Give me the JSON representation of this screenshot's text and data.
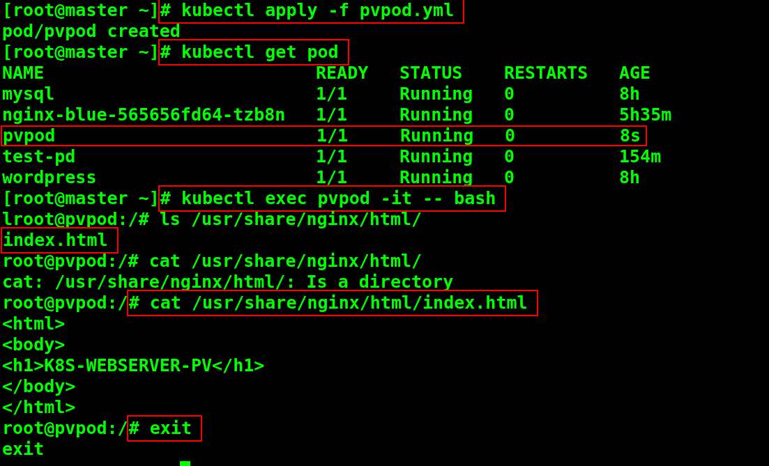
{
  "lines": [
    {
      "kind": "text",
      "parts": [
        {
          "text": "[root@master ~]",
          "boxed": false
        },
        {
          "text": "# kubectl apply -f pvpod.yml",
          "boxed": true
        }
      ]
    },
    {
      "kind": "text",
      "parts": [
        {
          "text": "pod/pvpod created",
          "boxed": false
        }
      ]
    },
    {
      "kind": "text",
      "parts": [
        {
          "text": "[root@master ~]",
          "boxed": false
        },
        {
          "text": "# kubectl get pod",
          "boxed": true
        }
      ]
    },
    {
      "kind": "table",
      "columns": [
        "NAME",
        "READY",
        "STATUS",
        "RESTARTS",
        "AGE"
      ],
      "rows": [
        {
          "boxed": false,
          "cells": [
            "mysql",
            "1/1",
            "Running",
            "0",
            "8h"
          ]
        },
        {
          "boxed": false,
          "cells": [
            "nginx-blue-565656fd64-tzb8n",
            "1/1",
            "Running",
            "0",
            "5h35m"
          ]
        },
        {
          "boxed": true,
          "cells": [
            "pvpod",
            "1/1",
            "Running",
            "0",
            "8s"
          ]
        },
        {
          "boxed": false,
          "cells": [
            "test-pd",
            "1/1",
            "Running",
            "0",
            "154m"
          ]
        },
        {
          "boxed": false,
          "cells": [
            "wordpress",
            "1/1",
            "Running",
            "0",
            "8h"
          ]
        }
      ]
    },
    {
      "kind": "text",
      "parts": [
        {
          "text": "[root@master ~]",
          "boxed": false
        },
        {
          "text": "# kubectl exec pvpod -it -- bash",
          "boxed": true
        }
      ]
    },
    {
      "kind": "text",
      "parts": [
        {
          "text": "lroot@pvpod:/# ls /usr/share/nginx/html/",
          "boxed": false
        }
      ]
    },
    {
      "kind": "text",
      "parts": [
        {
          "text": "index.html",
          "boxed": true
        }
      ]
    },
    {
      "kind": "text",
      "parts": [
        {
          "text": "root@pvpod:/# cat /usr/share/nginx/html/",
          "boxed": false
        }
      ]
    },
    {
      "kind": "text",
      "parts": [
        {
          "text": "cat: /usr/share/nginx/html/: Is a directory",
          "boxed": false
        }
      ]
    },
    {
      "kind": "text",
      "parts": [
        {
          "text": "root@pvpod:/",
          "boxed": false
        },
        {
          "text": "# cat /usr/share/nginx/html/index.html",
          "boxed": true
        }
      ]
    },
    {
      "kind": "text",
      "parts": [
        {
          "text": "<html>",
          "boxed": false
        }
      ]
    },
    {
      "kind": "text",
      "parts": [
        {
          "text": "<body>",
          "boxed": false
        }
      ]
    },
    {
      "kind": "text",
      "parts": [
        {
          "text": "<h1>K8S-WEBSERVER-PV</h1>",
          "boxed": false
        }
      ]
    },
    {
      "kind": "text",
      "parts": [
        {
          "text": "</body>",
          "boxed": false
        }
      ]
    },
    {
      "kind": "text",
      "parts": [
        {
          "text": "</html>",
          "boxed": false
        }
      ]
    },
    {
      "kind": "text",
      "parts": [
        {
          "text": "root@pvpod:/",
          "boxed": false
        },
        {
          "text": "# exit",
          "boxed": true
        }
      ]
    },
    {
      "kind": "text",
      "parts": [
        {
          "text": "exit",
          "boxed": false
        }
      ]
    },
    {
      "kind": "prompt",
      "cursor": true
    }
  ]
}
